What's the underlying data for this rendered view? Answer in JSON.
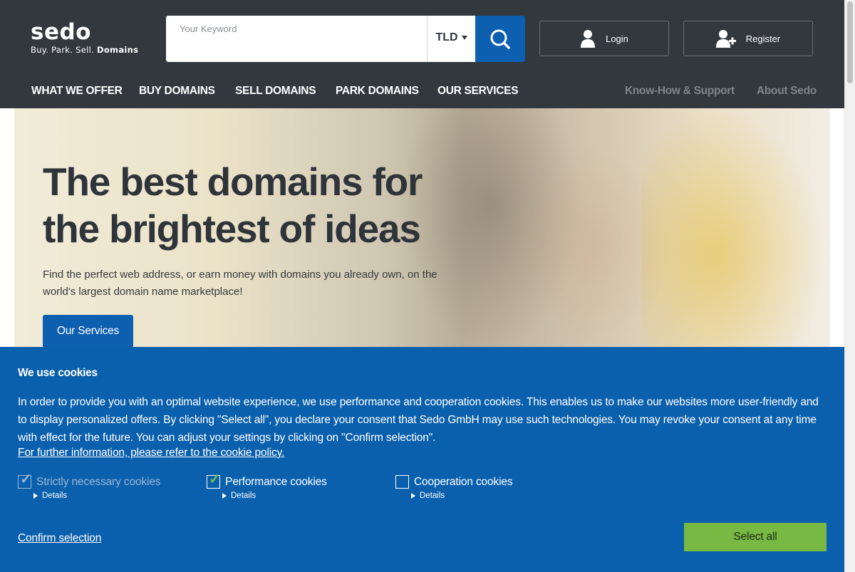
{
  "logo": {
    "word": "sedo",
    "tagline_prefix": "Buy. Park. Sell.",
    "tagline_bold": "Domains"
  },
  "search": {
    "placeholder": "Your Keyword",
    "tld_label": "TLD"
  },
  "account": {
    "login_label": "Login",
    "register_label": "Register"
  },
  "nav": {
    "items": [
      "WHAT WE OFFER",
      "BUY DOMAINS",
      "SELL DOMAINS",
      "PARK DOMAINS",
      "OUR SERVICES"
    ],
    "secondary": [
      "Know-How & Support",
      "About Sedo"
    ]
  },
  "hero": {
    "title_line1": "The best domains for",
    "title_line2": "the brightest of ideas",
    "text": "Find the perfect web address, or earn money with domains you already own, on the world's largest domain name marketplace!",
    "button_label": "Our Services"
  },
  "cookie": {
    "title": "We use cookies",
    "text": "In order to provide you with an optimal website experience, we use performance and cooperation cookies. This enables us to make our websites more user-friendly and to display personalized offers. By clicking \"Select all\", you declare your consent that Sedo GmbH may use such technologies. You may revoke your consent at any time with effect for the future. You can adjust your settings by clicking on \"Confirm selection\".",
    "policy_link": "For further information, please refer to the cookie policy.",
    "options": [
      {
        "label": "Strictly necessary cookies",
        "checked": true,
        "disabled": true,
        "details": "Details"
      },
      {
        "label": "Performance cookies",
        "checked": true,
        "disabled": false,
        "details": "Details"
      },
      {
        "label": "Cooperation cookies",
        "checked": false,
        "disabled": false,
        "details": "Details"
      }
    ],
    "confirm_label": "Confirm selection",
    "select_all_label": "Select all"
  },
  "colors": {
    "header_bg": "#33383f",
    "brand_blue": "#0d5fb0",
    "cookie_bg": "#0a60ad",
    "accept_green": "#77b943",
    "check_green": "#6cc24a"
  },
  "icons": [
    "search-icon",
    "user-icon",
    "user-add-icon",
    "caret-down-icon",
    "checkmark-icon",
    "triangle-right-icon"
  ]
}
